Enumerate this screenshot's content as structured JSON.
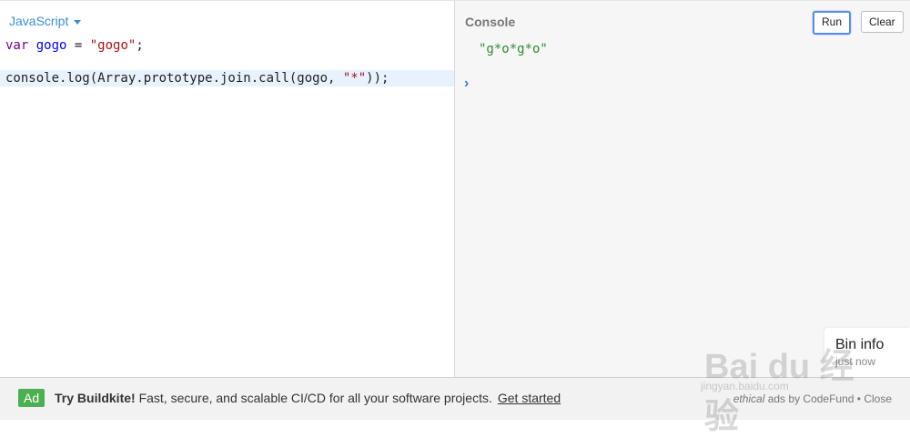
{
  "editor": {
    "language_label": "JavaScript",
    "line1": {
      "kw": "var",
      "def": "gogo",
      "op": " = ",
      "str": "\"gogo\"",
      "end": ";"
    },
    "line2": {
      "pre": "console.log(Array.prototype.join.call(gogo, ",
      "str": "\"*\"",
      "post": "));"
    }
  },
  "console": {
    "title": "Console",
    "run_label": "Run",
    "clear_label": "Clear",
    "output": "\"g*o*g*o\"",
    "prompt_icon": "chevron-right-icon"
  },
  "bin_info": {
    "title": "Bin info",
    "subtitle": "just now"
  },
  "ad": {
    "badge": "Ad",
    "headline": "Try Buildkite!",
    "body": " Fast, secure, and scalable CI/CD for all your software projects.",
    "cta": "Get started",
    "ethical": "ethical",
    "ads_by": " ads by CodeFund",
    "separator": " • ",
    "close": "Close"
  },
  "watermark": {
    "logo_text": "Bai du 经验",
    "url": "jingyan.baidu.com"
  },
  "colors": {
    "accent": "#3a8fd8",
    "output_green": "#2c8c2c",
    "ad_badge": "#4caf50"
  }
}
